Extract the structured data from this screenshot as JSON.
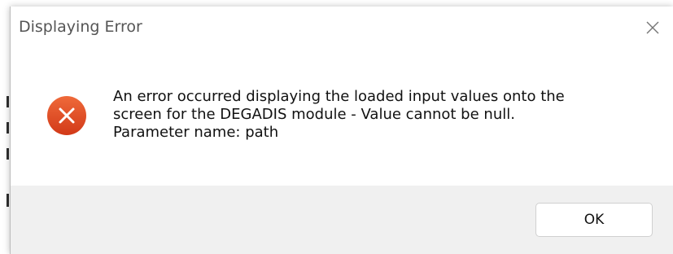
{
  "dialog": {
    "title": "Displaying Error",
    "message_lines": [
      "An error occurred displaying the loaded input values onto the",
      "screen for the DEGADIS module - Value cannot be null.",
      "Parameter name: path"
    ],
    "ok_label": "OK",
    "icons": {
      "close": "close-icon",
      "error": "error-icon"
    },
    "colors": {
      "error_icon": "#e0461f",
      "footer": "#f0f0f0",
      "title_text": "#555555"
    }
  }
}
